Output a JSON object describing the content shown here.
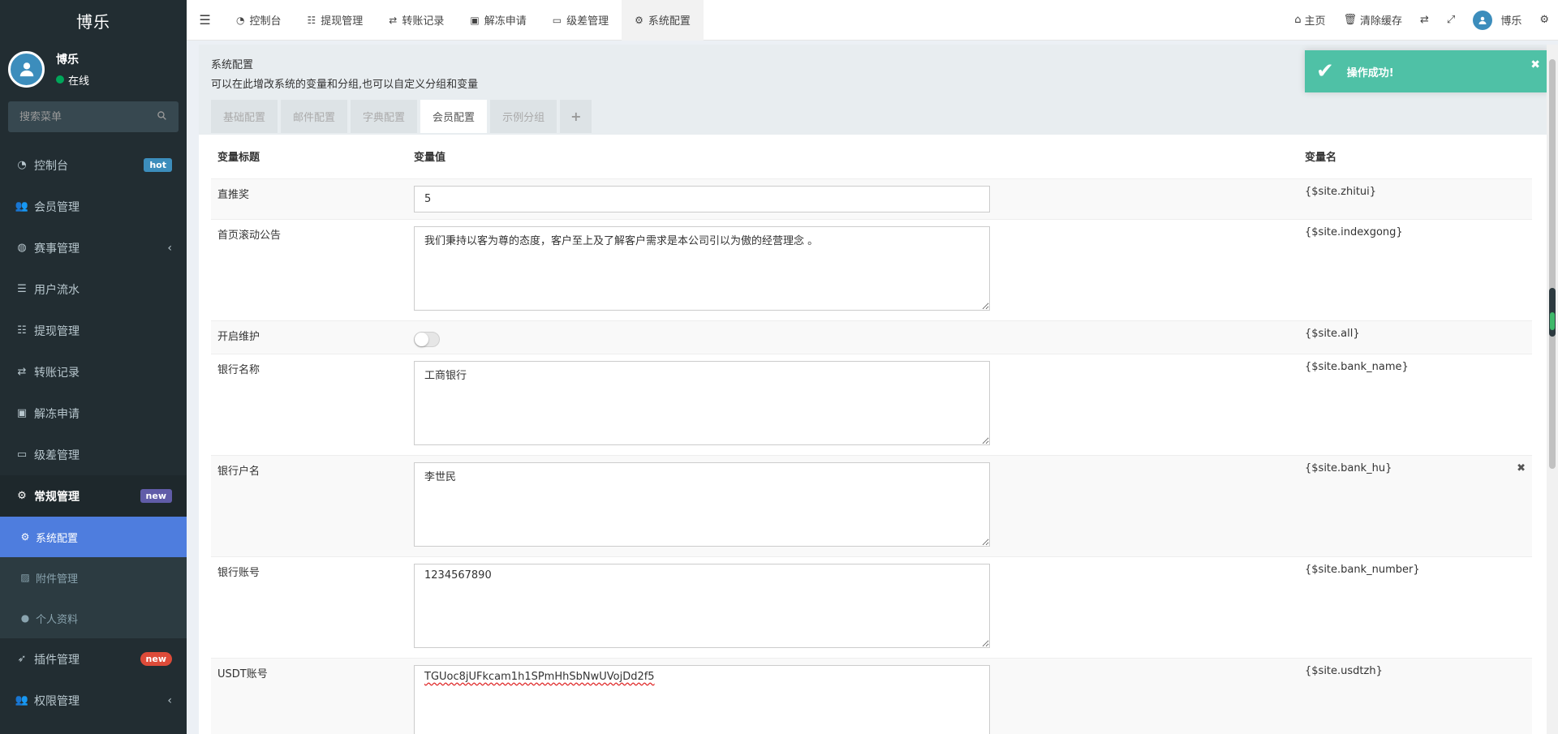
{
  "app": {
    "logo": "博乐"
  },
  "user": {
    "name": "博乐",
    "status": "在线"
  },
  "search": {
    "placeholder": "搜索菜单"
  },
  "sidebar": {
    "items": [
      {
        "label": "控制台",
        "icon": "dashboard-icon",
        "badge": "hot"
      },
      {
        "label": "会员管理",
        "icon": "users-icon"
      },
      {
        "label": "赛事管理",
        "icon": "globe-icon"
      },
      {
        "label": "用户流水",
        "icon": "list-icon"
      },
      {
        "label": "提现管理",
        "icon": "list-indent-icon"
      },
      {
        "label": "转账记录",
        "icon": "transfer-icon"
      },
      {
        "label": "解冻申请",
        "icon": "image-icon"
      },
      {
        "label": "级差管理",
        "icon": "window-icon"
      },
      {
        "label": "常规管理",
        "icon": "cogs-icon",
        "badge": "new"
      }
    ],
    "submenu": [
      {
        "label": "系统配置",
        "icon": "gear-icon"
      },
      {
        "label": "附件管理",
        "icon": "file-image-icon"
      },
      {
        "label": "个人资料",
        "icon": "user-icon"
      }
    ],
    "bottom": [
      {
        "label": "插件管理",
        "icon": "rocket-icon",
        "badge": "new"
      },
      {
        "label": "权限管理",
        "icon": "users-icon"
      }
    ]
  },
  "topnav": {
    "tabs": [
      {
        "label": "控制台",
        "icon": "dashboard-icon"
      },
      {
        "label": "提现管理",
        "icon": "list-indent-icon"
      },
      {
        "label": "转账记录",
        "icon": "transfer-icon"
      },
      {
        "label": "解冻申请",
        "icon": "image-icon"
      },
      {
        "label": "级差管理",
        "icon": "window-icon"
      },
      {
        "label": "系统配置",
        "icon": "gear-icon"
      }
    ],
    "right": {
      "home": "主页",
      "clear_cache": "清除缓存",
      "user": "博乐"
    }
  },
  "panel": {
    "title": "系统配置",
    "description": "可以在此增改系统的变量和分组,也可以自定义分组和变量",
    "tabs": [
      "基础配置",
      "邮件配置",
      "字典配置",
      "会员配置",
      "示例分组"
    ],
    "add_tab": "+"
  },
  "table": {
    "headers": {
      "title": "变量标题",
      "value": "变量值",
      "name": "变量名"
    },
    "rows": [
      {
        "title": "直推奖",
        "value": "5",
        "var": "{$site.zhitui}"
      },
      {
        "title": "首页滚动公告",
        "value": "我们秉持以客为尊的态度，客户至上及了解客户需求是本公司引以为傲的经营理念 。",
        "var": "{$site.indexgong}"
      },
      {
        "title": "开启维护",
        "value": "off",
        "var": "{$site.all}"
      },
      {
        "title": "银行名称",
        "value": "工商银行",
        "var": "{$site.bank_name}"
      },
      {
        "title": "银行户名",
        "value": "李世民",
        "var": "{$site.bank_hu}"
      },
      {
        "title": "银行账号",
        "value": "1234567890",
        "var": "{$site.bank_number}"
      },
      {
        "title": "USDT账号",
        "value": "TGUoc8jUFkcam1h1SPmHhSbNwUVojDd2f5",
        "var": "{$site.usdtzh}"
      }
    ]
  },
  "toast": {
    "message": "操作成功!"
  },
  "colors": {
    "sidebar": "#222d32",
    "active": "#4e7dde",
    "toast": "#4fc1a6",
    "brand": "#3c8dbc"
  }
}
